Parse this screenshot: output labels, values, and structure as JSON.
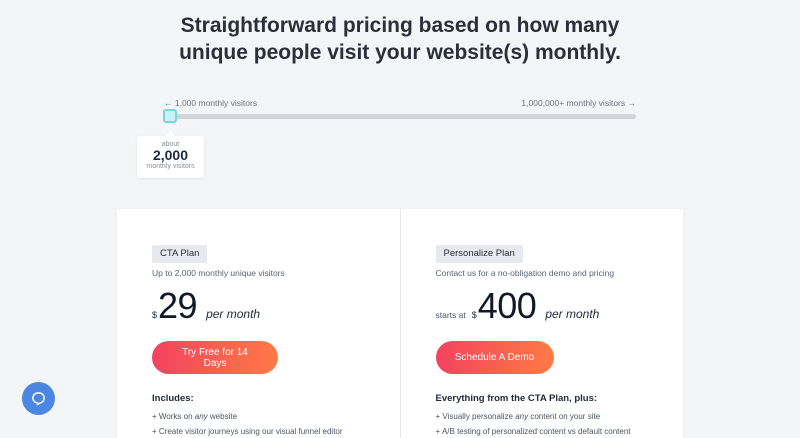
{
  "headline": {
    "line1": "Straightforward pricing based on how many",
    "line2": "unique people visit your website(s) monthly."
  },
  "slider": {
    "min_label": "← 1,000 monthly visitors",
    "max_label": "1,000,000+ monthly visitors →",
    "value_fraction": 0.001,
    "bubble": {
      "prefix": "about",
      "value": "2,000",
      "suffix": "monthly visitors"
    }
  },
  "plans": [
    {
      "tag": "CTA Plan",
      "description": "Up to 2,000 monthly unique visitors",
      "starts_at": "",
      "currency": "$",
      "amount": "29",
      "period": "per month",
      "button": "Try Free for 14 Days",
      "includes_title": "Includes:",
      "features": [
        {
          "prefix": "+ Works on ",
          "em": "any",
          "suffix": " website"
        },
        {
          "prefix": "+ Create visitor journeys using our visual funnel editor",
          "em": "",
          "suffix": ""
        }
      ]
    },
    {
      "tag": "Personalize Plan",
      "description": "Contact us for a no-obligation demo and pricing",
      "starts_at": "starts at",
      "currency": "$",
      "amount": "400",
      "period": "per month",
      "button": "Schedule A Demo",
      "includes_title": "Everything from the CTA Plan, plus:",
      "features": [
        {
          "prefix": "+ Visually personalize ",
          "em": "any",
          "suffix": " content on your site"
        },
        {
          "prefix": "+ A/B testing of personalized content vs default content",
          "em": "",
          "suffix": ""
        }
      ]
    }
  ],
  "chat_widget": {
    "icon": "chat-icon"
  },
  "colors": {
    "background": "#f4f5f7",
    "button_gradient_start": "#f3425f",
    "button_gradient_end": "#ff7a45",
    "slider_thumb": "#7bd6dc",
    "chat_widget": "#4b86e3"
  }
}
